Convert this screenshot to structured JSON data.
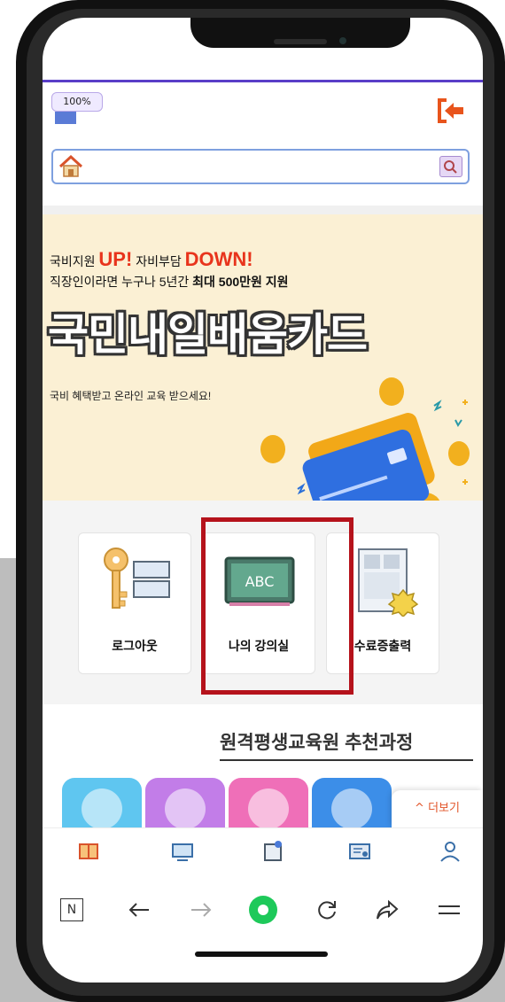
{
  "zoom": {
    "label": "100%"
  },
  "colors": {
    "accent": "#e8341c",
    "highlight": "#b5121b",
    "more": "#e2552a",
    "browser_green": "#1ec95a"
  },
  "banner": {
    "line1_a": "국비지원 ",
    "line1_up": "UP!",
    "line1_b": " 자비부담 ",
    "line1_down": "DOWN!",
    "line2_a": "직장인이라면 누구나 5년간 ",
    "line2_b": "최대 500만원 지원",
    "title": "국민내일배움카드",
    "sub": "국비 혜택받고 온라인 교육 받으세요!"
  },
  "menu": [
    {
      "label": "로그아웃",
      "icon": "key-icon"
    },
    {
      "label": "나의 강의실",
      "icon": "chalkboard-icon"
    },
    {
      "label": "수료증출력",
      "icon": "certificate-icon"
    }
  ],
  "recommend": {
    "title": "원격평생교육원 추천과정"
  },
  "categories": [
    {
      "color": "#5fc6f0",
      "icon": "scales-icon"
    },
    {
      "color": "#c27de8",
      "icon": "office-worker-icon"
    },
    {
      "color": "#ef6fb8",
      "icon": "building-icon"
    },
    {
      "color": "#3c8ee8",
      "icon": "presentation-icon"
    }
  ],
  "more": {
    "label": "^ 더보기"
  },
  "app_nav": [
    {
      "icon": "book-icon"
    },
    {
      "icon": "monitor-icon"
    },
    {
      "icon": "puzzle-icon"
    },
    {
      "icon": "certificate-list-icon"
    },
    {
      "icon": "person-icon"
    }
  ],
  "browser_nav": {
    "n_label": "N",
    "icons": [
      "naver-icon",
      "back-arrow-icon",
      "forward-arrow-icon",
      "home-circle-icon",
      "reload-icon",
      "share-icon",
      "menu-icon"
    ]
  }
}
